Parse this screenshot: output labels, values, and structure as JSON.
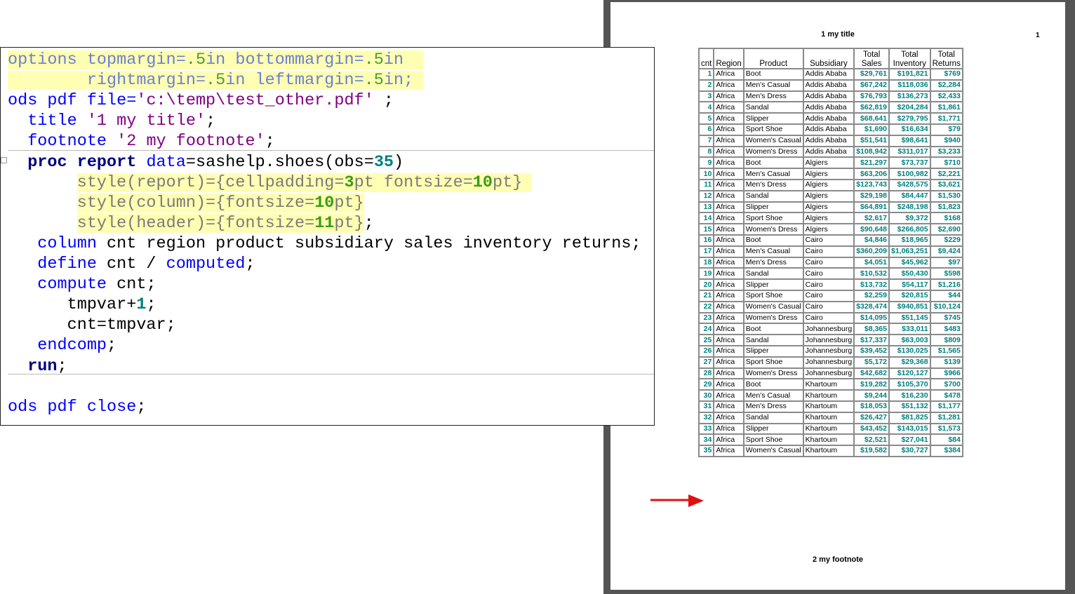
{
  "code": {
    "lines": [
      [
        [
          "options topmargin=",
          "fb hl"
        ],
        [
          ".5",
          "fn hl"
        ],
        [
          "in bottommargin=",
          "fb hl"
        ],
        [
          ".5",
          "fn hl"
        ],
        [
          "in  ",
          "fb hl"
        ]
      ],
      [
        [
          "        rightmargin=",
          "fb hl"
        ],
        [
          ".5",
          "fn hl"
        ],
        [
          "in leftmargin=",
          "fb hl"
        ],
        [
          ".5",
          "fn hl"
        ],
        [
          "in; ",
          "fb hl"
        ]
      ],
      [
        [
          "ods pdf file=",
          "kw"
        ],
        [
          "'c:\\temp\\test_other.pdf'",
          "str"
        ],
        [
          " ;",
          "plain"
        ]
      ],
      [
        [
          "  title ",
          "kw"
        ],
        [
          "'1 my title'",
          "str"
        ],
        [
          ";",
          "plain"
        ]
      ],
      [
        [
          "  footnote ",
          "kw"
        ],
        [
          "'2 my footnote'",
          "str"
        ],
        [
          ";",
          "plain"
        ]
      ],
      [
        [
          "  proc report ",
          "bold"
        ],
        [
          "data",
          "kw"
        ],
        [
          "=sashelp.shoes(obs=",
          "plain"
        ],
        [
          "35",
          "num"
        ],
        [
          ")",
          "plain"
        ]
      ],
      [
        [
          "       ",
          "plain"
        ],
        [
          "style(report)={cellpadding=",
          "gray hl"
        ],
        [
          "3",
          "gn hl"
        ],
        [
          "pt fontsize=",
          "gray hl"
        ],
        [
          "10",
          "gn hl"
        ],
        [
          "pt} ",
          "gray hl"
        ]
      ],
      [
        [
          "       ",
          "plain"
        ],
        [
          "style(column)={fontsize=",
          "gray hl"
        ],
        [
          "10",
          "gn hl"
        ],
        [
          "pt}",
          "gray hl"
        ]
      ],
      [
        [
          "       ",
          "plain"
        ],
        [
          "style(header)={fontsize=",
          "gray hl"
        ],
        [
          "11",
          "gn hl"
        ],
        [
          "pt}",
          "gray hl"
        ],
        [
          ";",
          "plain"
        ]
      ],
      [
        [
          "   column",
          "kw"
        ],
        [
          " cnt region product subsidiary sales inventory returns;",
          "plain"
        ]
      ],
      [
        [
          "   define",
          "kw"
        ],
        [
          " cnt / ",
          "plain"
        ],
        [
          "computed",
          "kw"
        ],
        [
          ";",
          "plain"
        ]
      ],
      [
        [
          "   compute",
          "kw"
        ],
        [
          " cnt;",
          "plain"
        ]
      ],
      [
        [
          "      tmpvar+",
          "plain"
        ],
        [
          "1",
          "num"
        ],
        [
          ";",
          "plain"
        ]
      ],
      [
        [
          "      cnt=tmpvar;",
          "plain"
        ]
      ],
      [
        [
          "   endcomp",
          "kw"
        ],
        [
          ";",
          "plain"
        ]
      ],
      [
        [
          "  run",
          "bold"
        ],
        [
          ";",
          "plain"
        ]
      ],
      [],
      [
        [
          "ods pdf close",
          "kw"
        ],
        [
          ";",
          "plain"
        ]
      ]
    ]
  },
  "pdf": {
    "title": "1 my title",
    "page_number": "1",
    "footnote": "2 my footnote",
    "headers": [
      "cnt",
      "Region",
      "Product",
      "Subsidiary",
      "Total\nSales",
      "Total\nInventory",
      "Total\nReturns"
    ],
    "rows": [
      [
        "1",
        "Africa",
        "Boot",
        "Addis Ababa",
        "$29,761",
        "$191,821",
        "$769"
      ],
      [
        "2",
        "Africa",
        "Men's Casual",
        "Addis Ababa",
        "$67,242",
        "$118,036",
        "$2,284"
      ],
      [
        "3",
        "Africa",
        "Men's Dress",
        "Addis Ababa",
        "$76,793",
        "$136,273",
        "$2,433"
      ],
      [
        "4",
        "Africa",
        "Sandal",
        "Addis Ababa",
        "$62,819",
        "$204,284",
        "$1,861"
      ],
      [
        "5",
        "Africa",
        "Slipper",
        "Addis Ababa",
        "$68,641",
        "$279,795",
        "$1,771"
      ],
      [
        "6",
        "Africa",
        "Sport Shoe",
        "Addis Ababa",
        "$1,690",
        "$16,634",
        "$79"
      ],
      [
        "7",
        "Africa",
        "Women's Casual",
        "Addis Ababa",
        "$51,541",
        "$98,641",
        "$940"
      ],
      [
        "8",
        "Africa",
        "Women's Dress",
        "Addis Ababa",
        "$108,942",
        "$311,017",
        "$3,233"
      ],
      [
        "9",
        "Africa",
        "Boot",
        "Algiers",
        "$21,297",
        "$73,737",
        "$710"
      ],
      [
        "10",
        "Africa",
        "Men's Casual",
        "Algiers",
        "$63,206",
        "$100,982",
        "$2,221"
      ],
      [
        "11",
        "Africa",
        "Men's Dress",
        "Algiers",
        "$123,743",
        "$428,575",
        "$3,621"
      ],
      [
        "12",
        "Africa",
        "Sandal",
        "Algiers",
        "$29,198",
        "$84,447",
        "$1,530"
      ],
      [
        "13",
        "Africa",
        "Slipper",
        "Algiers",
        "$64,891",
        "$248,198",
        "$1,823"
      ],
      [
        "14",
        "Africa",
        "Sport Shoe",
        "Algiers",
        "$2,617",
        "$9,372",
        "$168"
      ],
      [
        "15",
        "Africa",
        "Women's Dress",
        "Algiers",
        "$90,648",
        "$266,805",
        "$2,690"
      ],
      [
        "16",
        "Africa",
        "Boot",
        "Cairo",
        "$4,846",
        "$18,965",
        "$229"
      ],
      [
        "17",
        "Africa",
        "Men's Casual",
        "Cairo",
        "$360,209",
        "$1,063,251",
        "$9,424"
      ],
      [
        "18",
        "Africa",
        "Men's Dress",
        "Cairo",
        "$4,051",
        "$45,962",
        "$97"
      ],
      [
        "19",
        "Africa",
        "Sandal",
        "Cairo",
        "$10,532",
        "$50,430",
        "$598"
      ],
      [
        "20",
        "Africa",
        "Slipper",
        "Cairo",
        "$13,732",
        "$54,117",
        "$1,216"
      ],
      [
        "21",
        "Africa",
        "Sport Shoe",
        "Cairo",
        "$2,259",
        "$20,815",
        "$44"
      ],
      [
        "22",
        "Africa",
        "Women's Casual",
        "Cairo",
        "$328,474",
        "$940,851",
        "$10,124"
      ],
      [
        "23",
        "Africa",
        "Women's Dress",
        "Cairo",
        "$14,095",
        "$51,145",
        "$745"
      ],
      [
        "24",
        "Africa",
        "Boot",
        "Johannesburg",
        "$8,365",
        "$33,011",
        "$483"
      ],
      [
        "25",
        "Africa",
        "Sandal",
        "Johannesburg",
        "$17,337",
        "$63,003",
        "$809"
      ],
      [
        "26",
        "Africa",
        "Slipper",
        "Johannesburg",
        "$39,452",
        "$130,025",
        "$1,565"
      ],
      [
        "27",
        "Africa",
        "Sport Shoe",
        "Johannesburg",
        "$5,172",
        "$29,368",
        "$139"
      ],
      [
        "28",
        "Africa",
        "Women's Dress",
        "Johannesburg",
        "$42,682",
        "$120,127",
        "$966"
      ],
      [
        "29",
        "Africa",
        "Boot",
        "Khartoum",
        "$19,282",
        "$105,370",
        "$700"
      ],
      [
        "30",
        "Africa",
        "Men's Casual",
        "Khartoum",
        "$9,244",
        "$16,230",
        "$478"
      ],
      [
        "31",
        "Africa",
        "Men's Dress",
        "Khartoum",
        "$18,053",
        "$51,132",
        "$1,177"
      ],
      [
        "32",
        "Africa",
        "Sandal",
        "Khartoum",
        "$26,427",
        "$81,825",
        "$1,281"
      ],
      [
        "33",
        "Africa",
        "Slipper",
        "Khartoum",
        "$43,452",
        "$143,015",
        "$1,573"
      ],
      [
        "34",
        "Africa",
        "Sport Shoe",
        "Khartoum",
        "$2,521",
        "$27,041",
        "$84"
      ],
      [
        "35",
        "Africa",
        "Women's Casual",
        "Khartoum",
        "$19,582",
        "$30,727",
        "$384"
      ]
    ]
  },
  "colors": {
    "arrow": "#e01010",
    "frame": "#555555",
    "highlight": "#ffffb3"
  }
}
